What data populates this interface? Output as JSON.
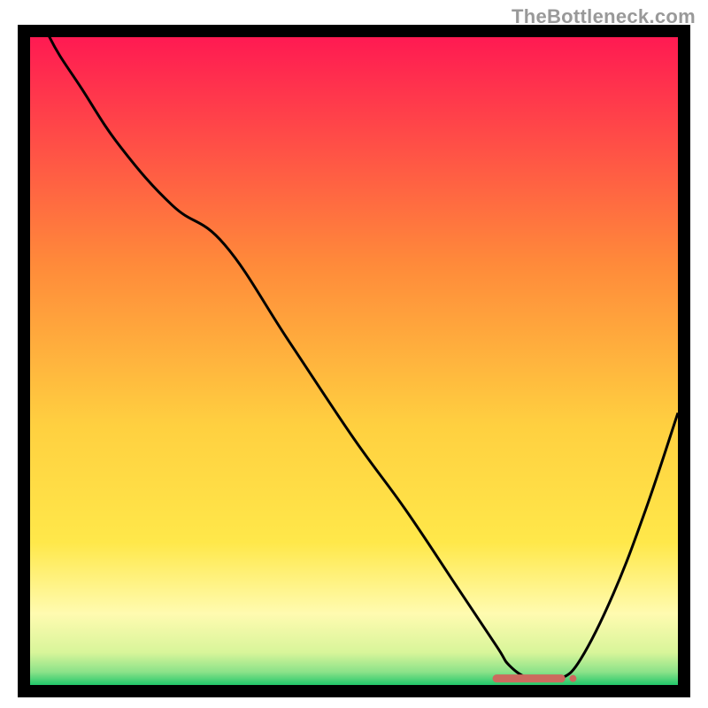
{
  "watermark": "TheBottleneck.com",
  "chart_data": {
    "type": "line",
    "title": "",
    "xlabel": "",
    "ylabel": "",
    "xlim": [
      0,
      100
    ],
    "ylim": [
      0,
      100
    ],
    "series": [
      {
        "name": "curve",
        "x": [
          0,
          3,
          8,
          14,
          22,
          30,
          40,
          50,
          58,
          66,
          72,
          74,
          77,
          80,
          82,
          85,
          90,
          95,
          100
        ],
        "y": [
          108,
          100,
          92,
          83,
          74,
          68,
          53,
          38,
          27,
          15,
          6,
          3,
          1,
          0.8,
          1,
          4,
          14,
          27,
          42
        ]
      }
    ],
    "flat_segment": {
      "x_start": 72,
      "x_end": 82,
      "y": 1.0
    },
    "background": {
      "type": "vertical-gradient",
      "stops": [
        {
          "offset": 0,
          "color": "#ff1a52"
        },
        {
          "offset": 35,
          "color": "#ff8a3a"
        },
        {
          "offset": 60,
          "color": "#ffd040"
        },
        {
          "offset": 78,
          "color": "#ffe84a"
        },
        {
          "offset": 89,
          "color": "#fffbb0"
        },
        {
          "offset": 95,
          "color": "#d8f59a"
        },
        {
          "offset": 98,
          "color": "#8be289"
        },
        {
          "offset": 100,
          "color": "#22c76a"
        }
      ]
    },
    "frame_color": "#000000",
    "curve_color": "#000000",
    "marker_color": "#cc6a5e"
  }
}
